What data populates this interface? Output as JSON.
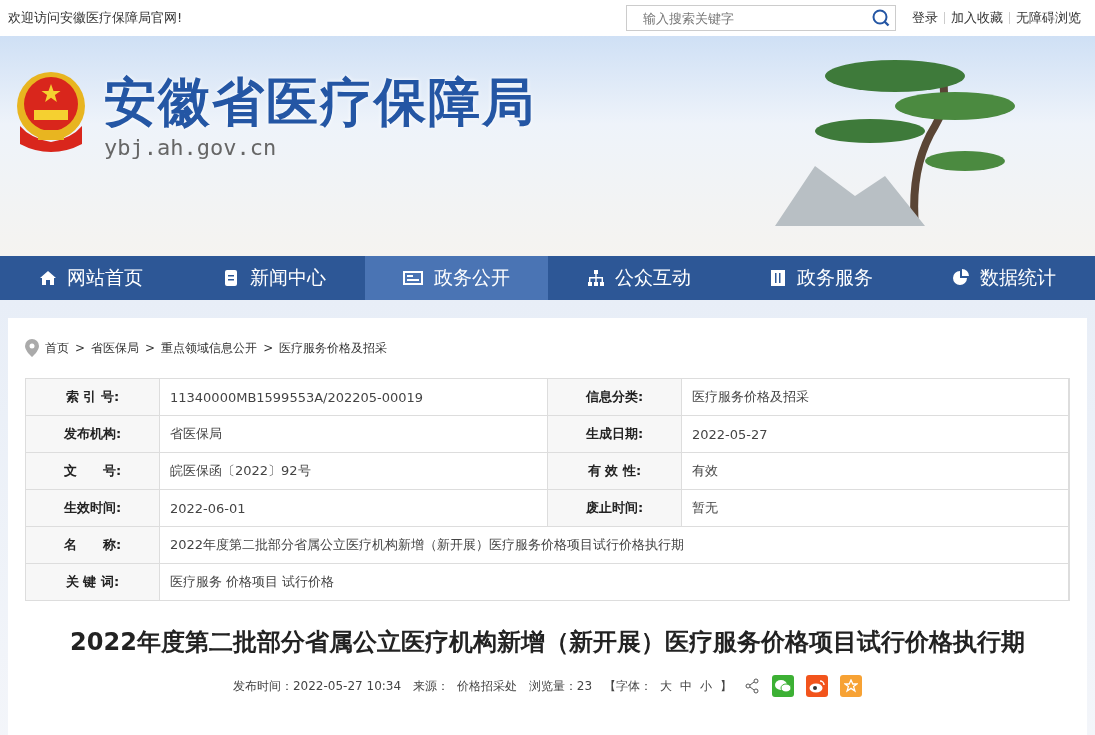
{
  "top_bar": {
    "welcome": "欢迎访问安徽医疗保障局官网!",
    "search": {
      "placeholder": "输入搜索关键字"
    },
    "links": [
      "登录",
      "加入收藏",
      "无障碍浏览"
    ]
  },
  "banner": {
    "title": "安徽省医疗保障局",
    "domain": "ybj.ah.gov.cn"
  },
  "nav": [
    {
      "label": "网站首页",
      "selected": false
    },
    {
      "label": "新闻中心",
      "selected": false
    },
    {
      "label": "政务公开",
      "selected": true
    },
    {
      "label": "公众互动",
      "selected": false
    },
    {
      "label": "政务服务",
      "selected": false
    },
    {
      "label": "数据统计",
      "selected": false
    }
  ],
  "breadcrumb": {
    "separator": ">",
    "items": [
      "首页",
      "省医保局",
      "重点领域信息公开",
      "医疗服务价格及招采"
    ]
  },
  "info_table": [
    [
      {
        "label": "索 引 号:",
        "value": "11340000MB1599553A/202205-00019"
      },
      {
        "label": "信息分类:",
        "value": "医疗服务价格及招采"
      }
    ],
    [
      {
        "label": "发布机构:",
        "value": "省医保局"
      },
      {
        "label": "生成日期:",
        "value": "2022-05-27"
      }
    ],
    [
      {
        "label": "文　　号:",
        "value": "皖医保函〔2022〕92号"
      },
      {
        "label": "有 效 性:",
        "value": "有效"
      }
    ],
    [
      {
        "label": "生效时间:",
        "value": "2022-06-01"
      },
      {
        "label": "废止时间:",
        "value": "暂无"
      }
    ],
    [
      {
        "label": "名　　称:",
        "value": "2022年度第二批部分省属公立医疗机构新增（新开展）医疗服务价格项目试行价格执行期"
      }
    ],
    [
      {
        "label": "关 键 词:",
        "value": "医疗服务 价格项目 试行价格"
      }
    ]
  ],
  "article": {
    "title": "2022年度第二批部分省属公立医疗机构新增（新开展）医疗服务价格项目试行价格执行期",
    "meta": [
      "发布时间：2022-05-27 10:34",
      "来源：  价格招采处",
      "浏览量：23"
    ],
    "font_size": {
      "open": "【字体：",
      "options": [
        "大",
        "中",
        "小"
      ],
      "close": "】"
    },
    "share": [
      {
        "kind": "wechat",
        "color": "#3cb034"
      },
      {
        "kind": "weibo",
        "color": "#f2541c"
      },
      {
        "kind": "star",
        "color": "#f7a234"
      }
    ]
  }
}
